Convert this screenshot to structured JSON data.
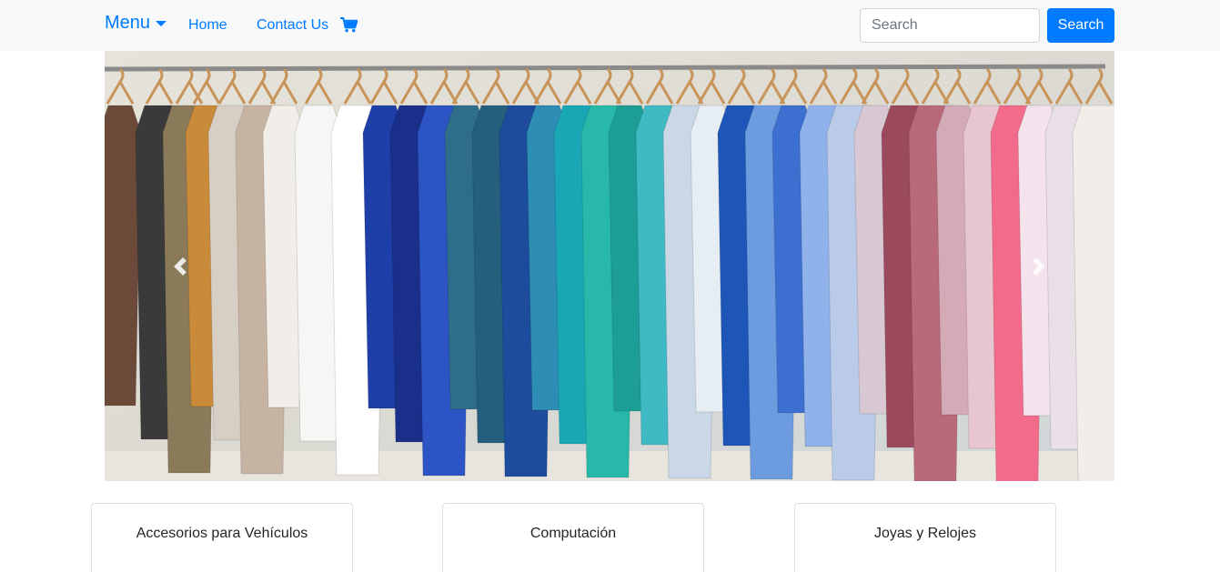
{
  "navbar": {
    "brand_label": "Menu",
    "links": [
      {
        "label": "Home"
      },
      {
        "label": "Contact Us"
      }
    ],
    "cart_icon": "shopping-cart-icon",
    "search": {
      "placeholder": "Search",
      "value": "",
      "button_label": "Search"
    }
  },
  "carousel": {
    "image_alt": "Clothes hanging on a rack",
    "prev_icon": "chevron-left-icon",
    "next_icon": "chevron-right-icon"
  },
  "categories": [
    {
      "title": "Accesorios para Vehículos"
    },
    {
      "title": "Computación"
    },
    {
      "title": "Joyas y Relojes"
    }
  ],
  "colors": {
    "primary": "#007bff",
    "navbar_bg": "#f8f9fa"
  }
}
